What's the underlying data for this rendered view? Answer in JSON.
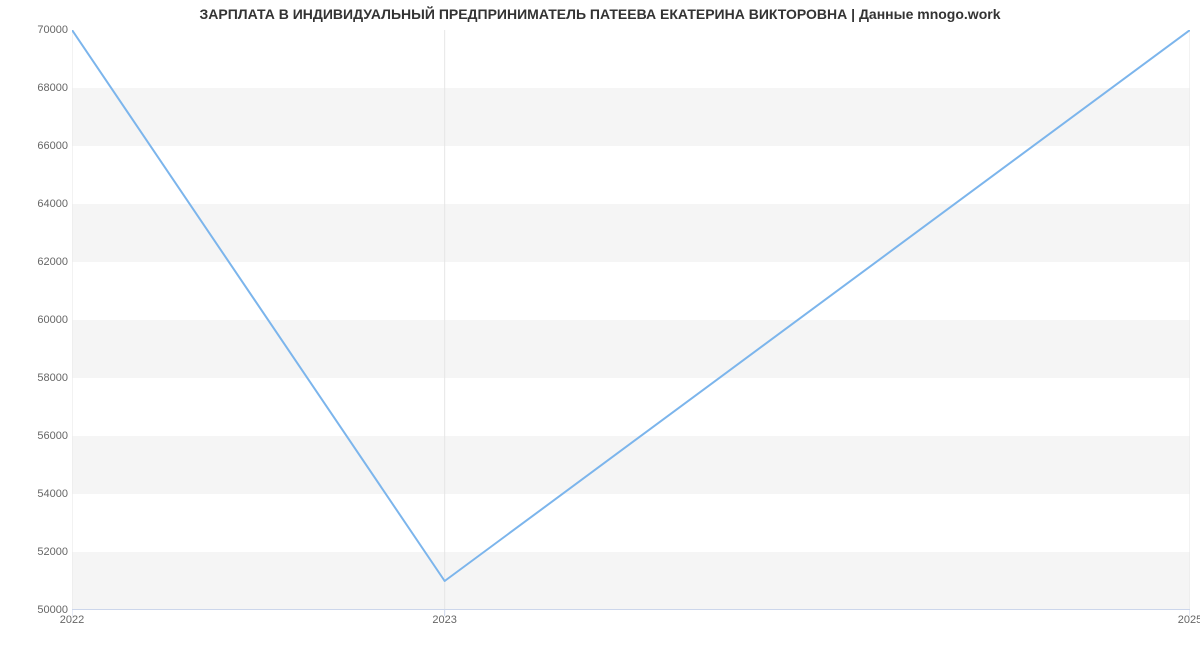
{
  "chart_data": {
    "type": "line",
    "title": "ЗАРПЛАТА В ИНДИВИДУАЛЬНЫЙ ПРЕДПРИНИМАТЕЛЬ ПАТЕЕВА ЕКАТЕРИНА ВИКТОРОВНА | Данные mnogo.work",
    "x": [
      2022,
      2023,
      2025
    ],
    "y": [
      70000,
      51000,
      70000
    ],
    "x_ticks": [
      2022,
      2023,
      2025
    ],
    "y_ticks": [
      50000,
      52000,
      54000,
      56000,
      58000,
      60000,
      62000,
      64000,
      66000,
      68000,
      70000
    ],
    "xlabel": "",
    "ylabel": "",
    "xlim": [
      2022,
      2025
    ],
    "ylim": [
      50000,
      70000
    ],
    "line_color": "#7cb5ec",
    "band_colors": [
      "#f5f5f5",
      "#ffffff"
    ]
  }
}
